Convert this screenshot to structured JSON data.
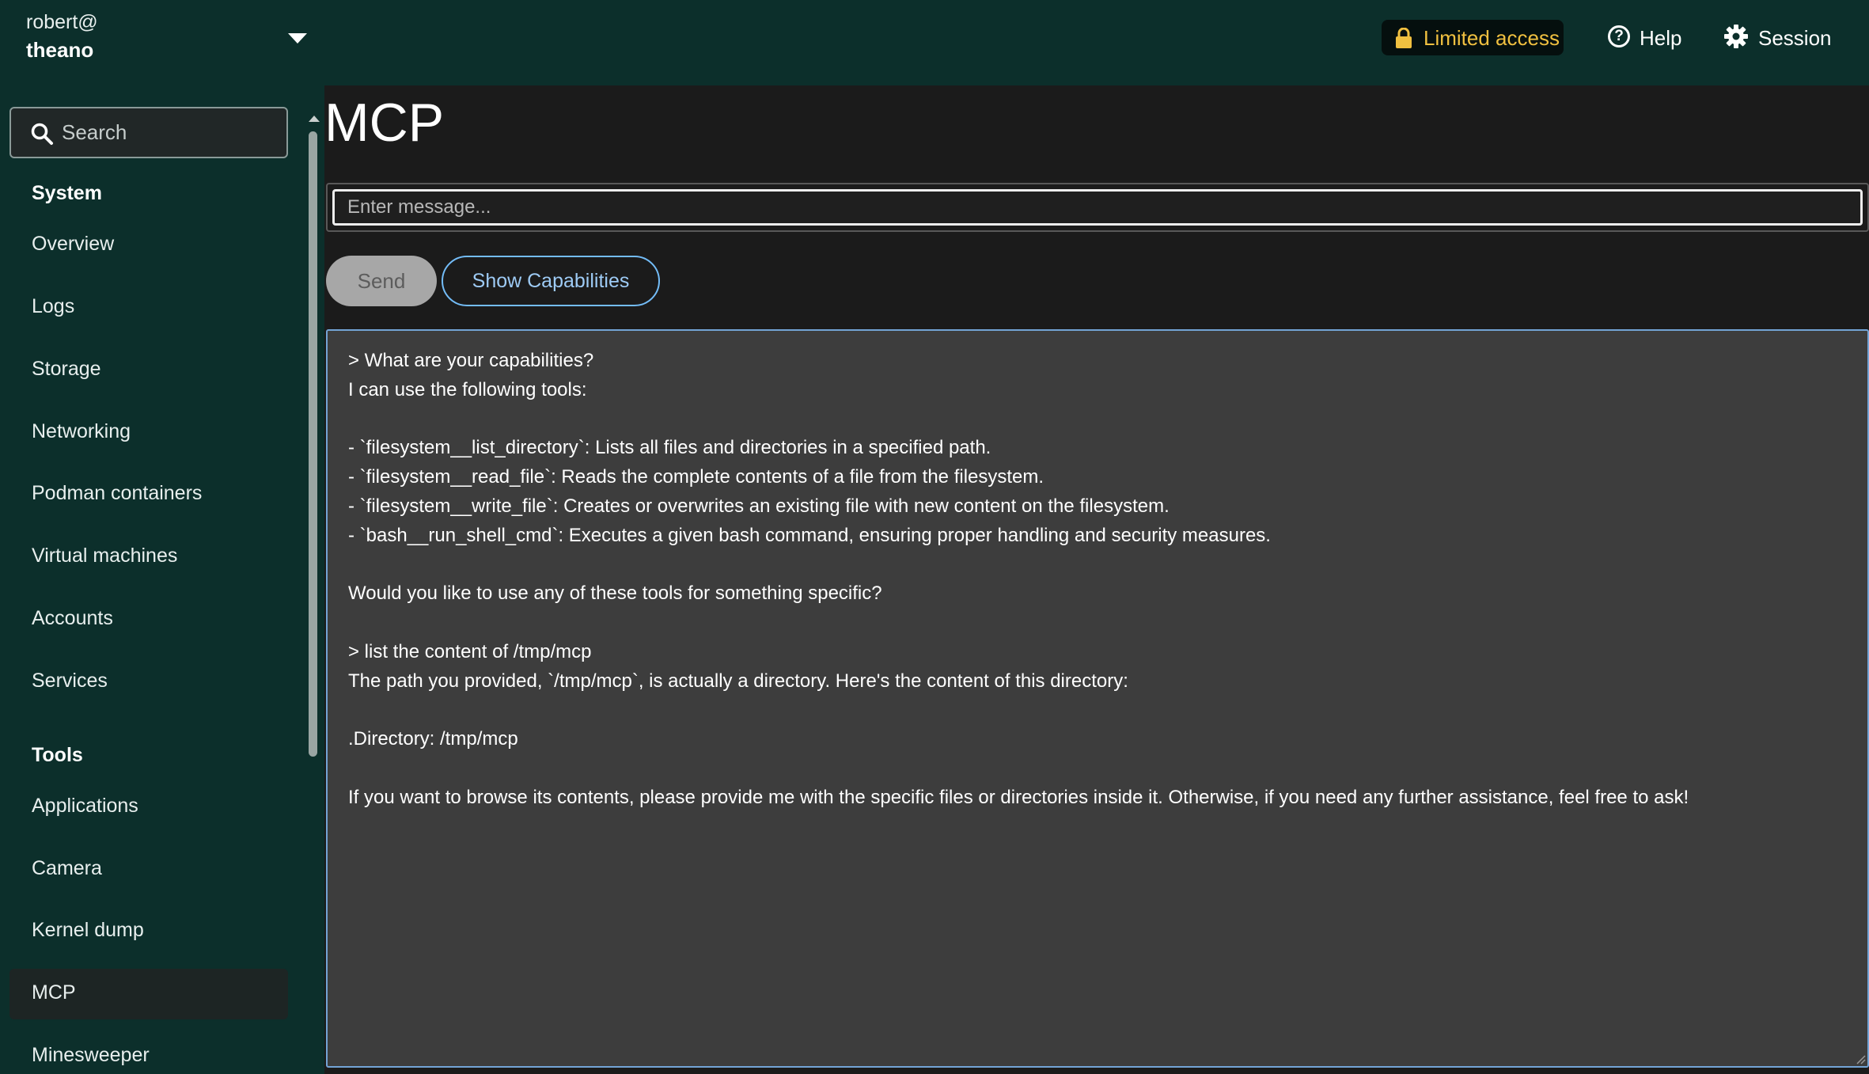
{
  "header": {
    "host_user": "robert@",
    "host_name": "theano",
    "limited_access_label": "Limited access",
    "help_label": "Help",
    "session_label": "Session",
    "colors": {
      "bar": "#0c2f2b",
      "limited_access": "#f0c040"
    }
  },
  "sidebar": {
    "search_placeholder": "Search",
    "sections": [
      {
        "heading": "System",
        "items": [
          "Overview",
          "Logs",
          "Storage",
          "Networking",
          "Podman containers",
          "Virtual machines",
          "Accounts",
          "Services"
        ]
      },
      {
        "heading": "Tools",
        "items": [
          "Applications",
          "Camera",
          "Kernel dump",
          "MCP",
          "Minesweeper"
        ]
      }
    ],
    "active_item": "MCP"
  },
  "main": {
    "title": "MCP",
    "message_placeholder": "Enter message...",
    "send_label": "Send",
    "show_capabilities_label": "Show Capabilities",
    "output_lines": [
      "> What are your capabilities?",
      "I can use the following tools:",
      "",
      "- `filesystem__list_directory`: Lists all files and directories in a specified path.",
      "- `filesystem__read_file`: Reads the complete contents of a file from the filesystem.",
      "- `filesystem__write_file`: Creates or overwrites an existing file with new content on the filesystem.",
      "- `bash__run_shell_cmd`: Executes a given bash command, ensuring proper handling and security measures.",
      "",
      "Would you like to use any of these tools for something specific?",
      "",
      "> list the content of /tmp/mcp",
      "The path you provided, `/tmp/mcp`, is actually a directory. Here's the content of this directory:",
      "",
      ".Directory: /tmp/mcp",
      "",
      "If you want to browse its contents, please provide me with the specific files or directories inside it. Otherwise, if you need any further assistance, feel free to ask!"
    ]
  }
}
